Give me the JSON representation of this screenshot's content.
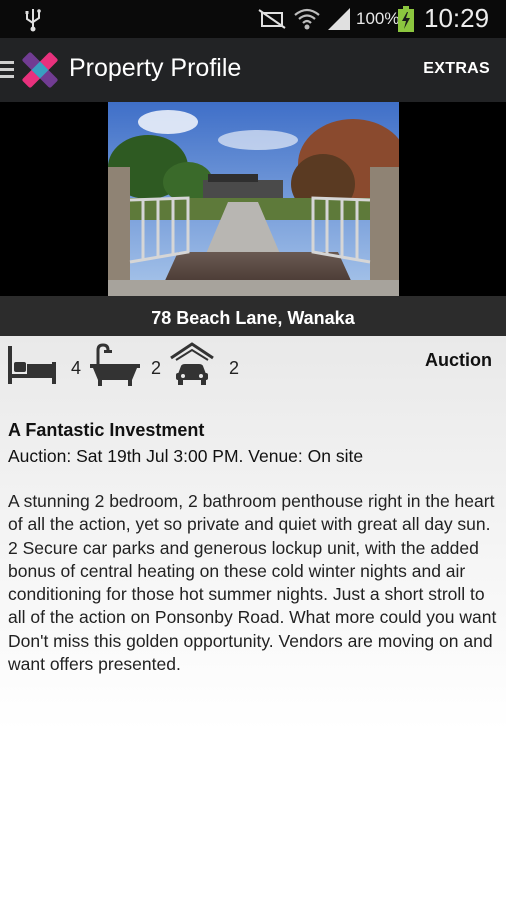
{
  "status_bar": {
    "icons": [
      "usb-icon",
      "mute-icon",
      "wifi-icon",
      "signal-icon",
      "battery-icon"
    ],
    "battery_percent": "100%",
    "time": "10:29"
  },
  "action_bar": {
    "title": "Property Profile",
    "extras_label": "EXTRAS",
    "logo_colors": [
      "#e8317d",
      "#7a3fa0",
      "#2bb0c8"
    ]
  },
  "listing": {
    "address": "78 Beach Lane, Wanaka",
    "features": {
      "bedrooms": "4",
      "bathrooms": "2",
      "garages": "2"
    },
    "sale_method": "Auction",
    "headline": "A Fantastic Investment",
    "auction_info": "Auction: Sat 19th Jul 3:00 PM. Venue: On site",
    "description": "A stunning 2 bedroom, 2 bathroom penthouse right in the heart of all the action, yet so private and quiet with great all day sun. 2 Secure car parks and generous lockup unit, with the added bonus of central heating on these cold winter nights and air conditioning for those hot summer nights. Just a short stroll to all of the action on Ponsonby Road. What more could you want Don't miss this golden opportunity. Vendors are moving on and want offers presented."
  }
}
